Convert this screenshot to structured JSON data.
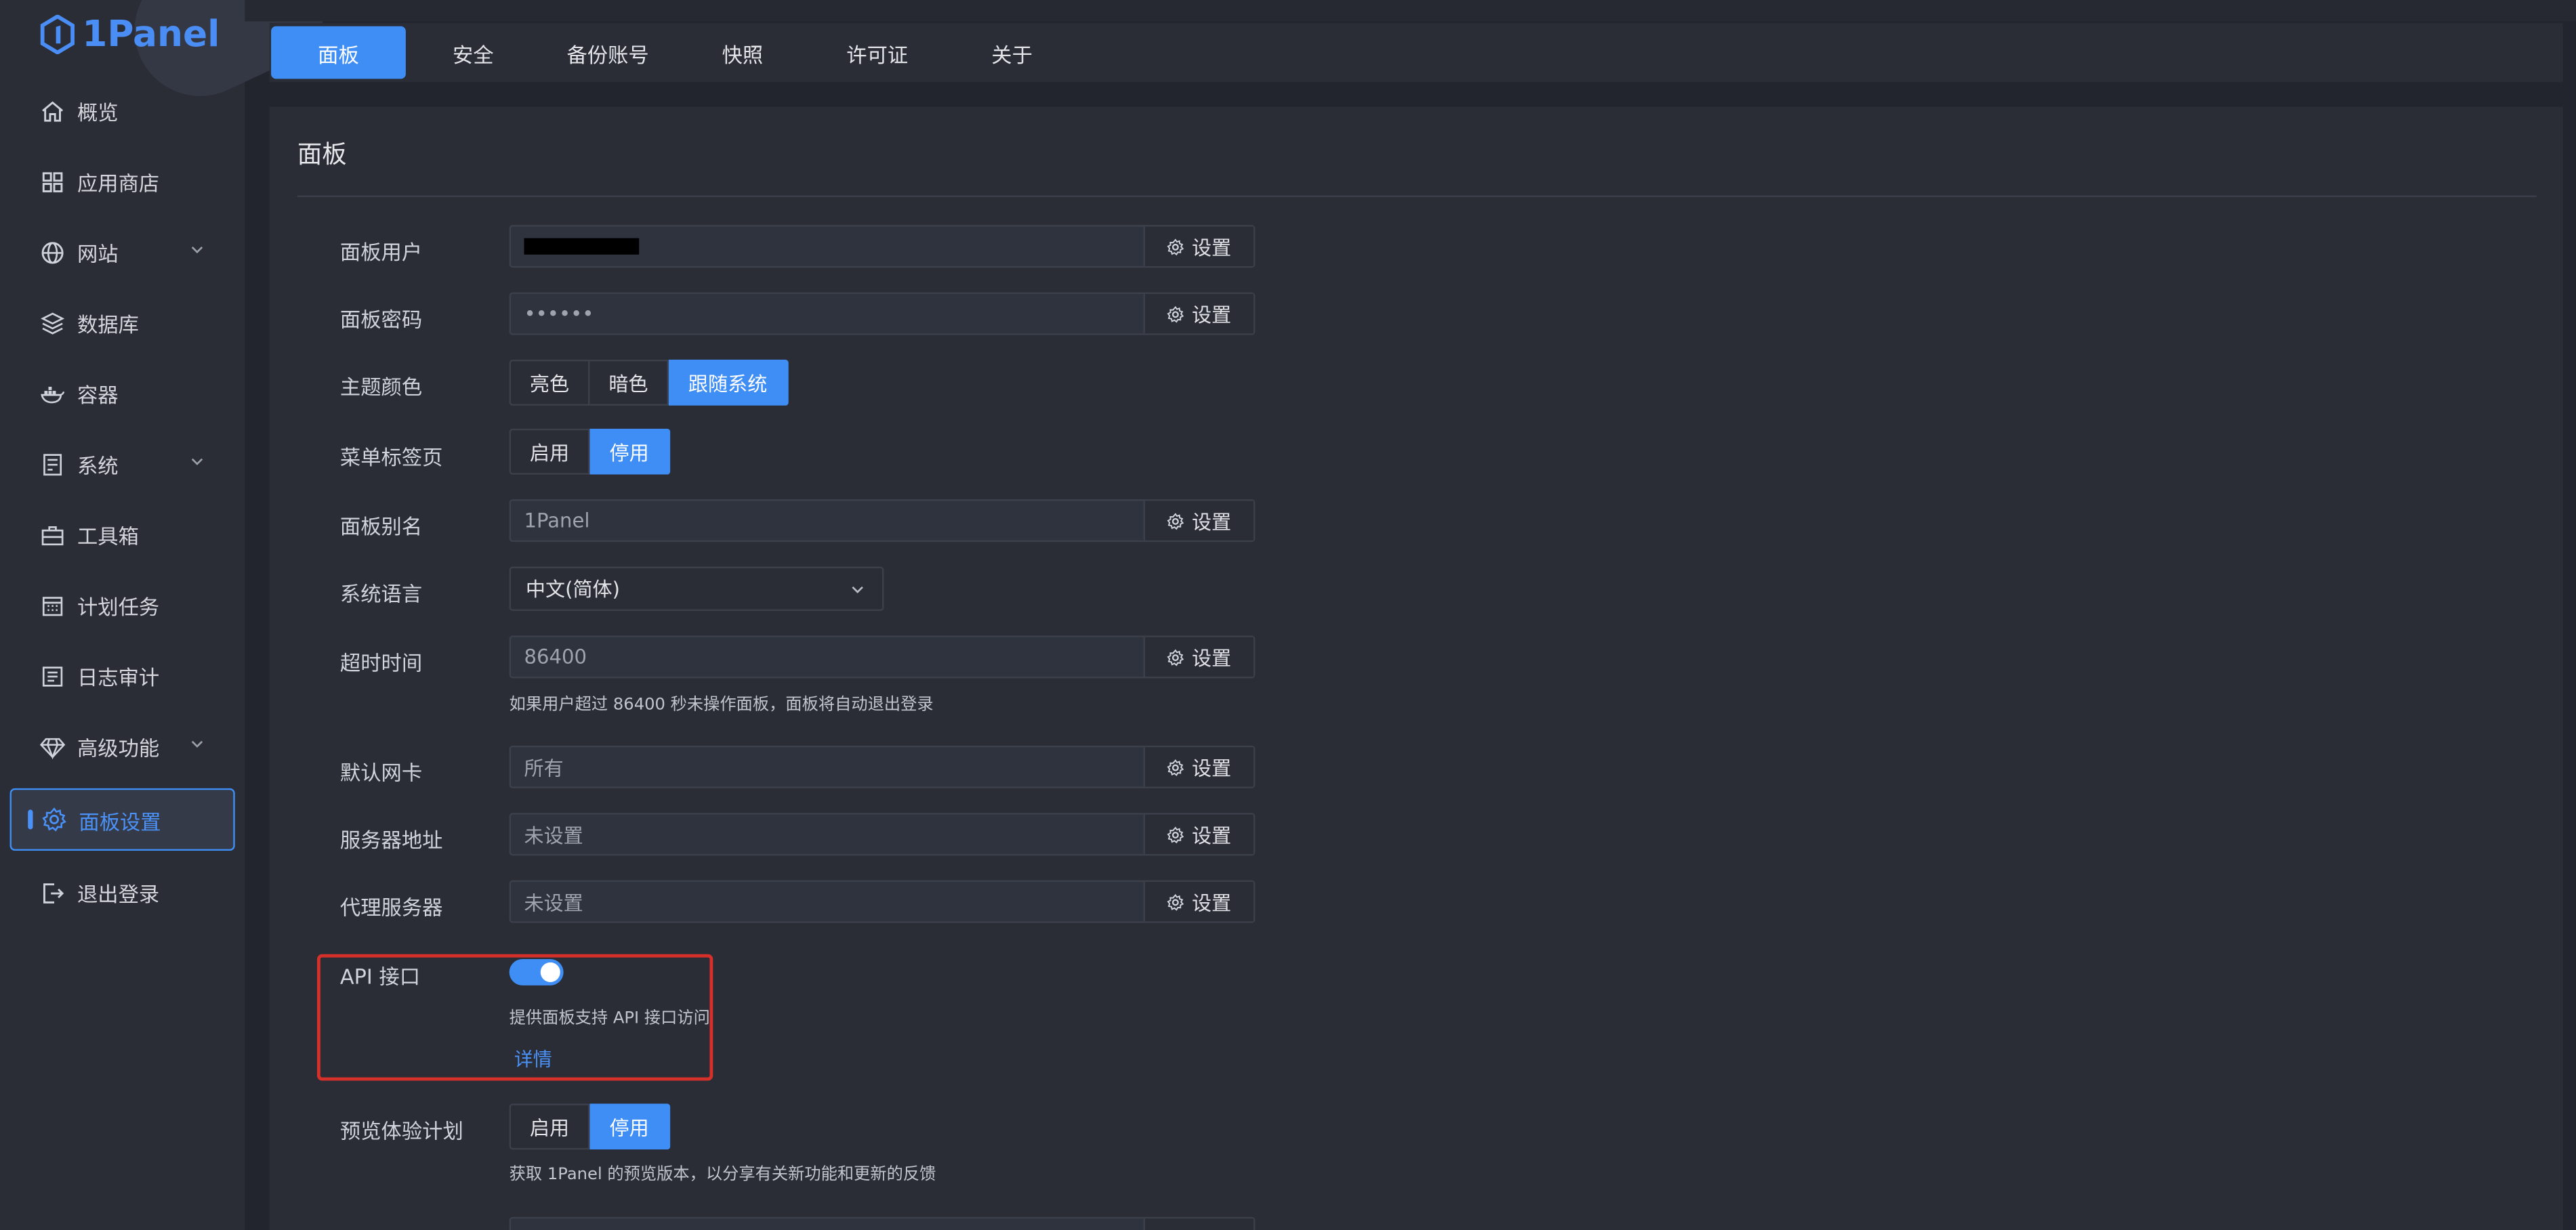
{
  "logo": {
    "text": "1Panel"
  },
  "sidebar": {
    "items": [
      {
        "label": "概览",
        "icon": "home-icon"
      },
      {
        "label": "应用商店",
        "icon": "grid-icon"
      },
      {
        "label": "网站",
        "icon": "globe-icon",
        "expandable": true
      },
      {
        "label": "数据库",
        "icon": "layers-icon"
      },
      {
        "label": "容器",
        "icon": "docker-icon"
      },
      {
        "label": "系统",
        "icon": "server-icon",
        "expandable": true
      },
      {
        "label": "工具箱",
        "icon": "toolbox-icon"
      },
      {
        "label": "计划任务",
        "icon": "calendar-icon"
      },
      {
        "label": "日志审计",
        "icon": "log-icon"
      },
      {
        "label": "高级功能",
        "icon": "diamond-icon",
        "expandable": true
      },
      {
        "label": "面板设置",
        "icon": "gear-icon",
        "active": true
      },
      {
        "label": "退出登录",
        "icon": "logout-icon"
      }
    ]
  },
  "tabs": [
    {
      "label": "面板",
      "active": true
    },
    {
      "label": "安全"
    },
    {
      "label": "备份账号"
    },
    {
      "label": "快照"
    },
    {
      "label": "许可证"
    },
    {
      "label": "关于"
    }
  ],
  "panel": {
    "title": "面板",
    "set_label": "设置",
    "user": {
      "label": "面板用户",
      "value": ""
    },
    "password": {
      "label": "面板密码",
      "value": "••••••"
    },
    "theme": {
      "label": "主题颜色",
      "options": [
        "亮色",
        "暗色",
        "跟随系统"
      ],
      "selected": "跟随系统"
    },
    "menu_tabs": {
      "label": "菜单标签页",
      "options": [
        "启用",
        "停用"
      ],
      "selected": "停用"
    },
    "alias": {
      "label": "面板别名",
      "value": "1Panel"
    },
    "language": {
      "label": "系统语言",
      "value": "中文(简体)"
    },
    "timeout": {
      "label": "超时时间",
      "value": "86400",
      "help": "如果用户超过 86400 秒未操作面板，面板将自动退出登录"
    },
    "nic": {
      "label": "默认网卡",
      "value": "所有"
    },
    "server_addr": {
      "label": "服务器地址",
      "value": "未设置"
    },
    "proxy": {
      "label": "代理服务器",
      "value": "未设置"
    },
    "api": {
      "label": "API 接口",
      "enabled": true,
      "help": "提供面板支持 API 接口访问",
      "link": "详情"
    },
    "preview": {
      "label": "预览体验计划",
      "options": [
        "启用",
        "停用"
      ],
      "selected": "停用",
      "help": "获取 1Panel 的预览版本，以分享有关新功能和更新的反馈"
    }
  },
  "colors": {
    "accent": "#3f8ef5",
    "highlight": "#d6302a",
    "background": "#22252d"
  }
}
